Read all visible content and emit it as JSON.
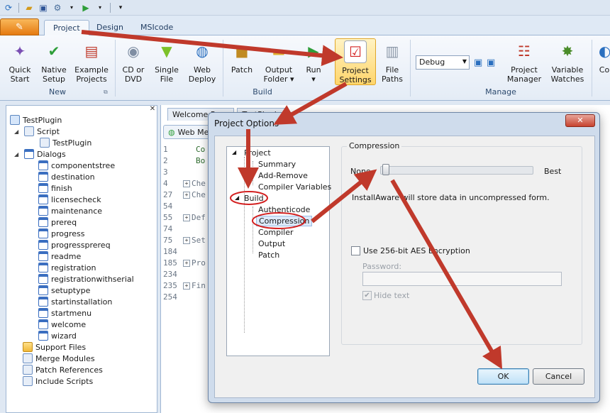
{
  "ribbon": {
    "tabs": [
      "Project",
      "Design",
      "MSIcode"
    ],
    "groups": {
      "new": {
        "label": "New",
        "buttons": [
          {
            "line1": "Quick",
            "line2": "Start",
            "icon": "wand-icon"
          },
          {
            "line1": "Native",
            "line2": "Setup",
            "icon": "check-circle-icon"
          },
          {
            "line1": "Example",
            "line2": "Projects",
            "icon": "document-stack-icon"
          }
        ]
      },
      "build": {
        "label": "Build",
        "buttons": [
          {
            "line1": "CD or",
            "line2": "DVD",
            "icon": "disc-icon"
          },
          {
            "line1": "Single",
            "line2": "File",
            "icon": "funnel-icon"
          },
          {
            "line1": "Web",
            "line2": "Deploy",
            "icon": "globe-icon"
          },
          {
            "line1": "Patch",
            "line2": "",
            "icon": "box-icon"
          },
          {
            "line1": "Output",
            "line2": "Folder ▾",
            "icon": "folder-icon"
          },
          {
            "line1": "Run",
            "line2": "▾",
            "icon": "play-icon"
          },
          {
            "line1": "Project",
            "line2": "Settings",
            "icon": "checklist-icon"
          },
          {
            "line1": "File",
            "line2": "Paths",
            "icon": "server-icon"
          }
        ]
      },
      "manage": {
        "label": "Manage",
        "config": "Debug",
        "buttons": [
          {
            "line1": "Project",
            "line2": "Manager",
            "icon": "hierarchy-icon"
          },
          {
            "line1": "Variable",
            "line2": "Watches",
            "icon": "bug-icon"
          }
        ],
        "partial": "Co"
      }
    }
  },
  "tree": {
    "root": "TestPlugin",
    "script": "Script",
    "script_child": "TestPlugin",
    "dialogs": "Dialogs",
    "dialog_items": [
      "componentstree",
      "destination",
      "finish",
      "licensecheck",
      "maintenance",
      "prereq",
      "progress",
      "progressprereq",
      "readme",
      "registration",
      "registrationwithserial",
      "setuptype",
      "startinstallation",
      "startmenu",
      "welcome",
      "wizard"
    ],
    "extras": [
      "Support Files",
      "Merge Modules",
      "Patch References",
      "Include Scripts"
    ]
  },
  "editor": {
    "tabs": [
      "Welcome Page",
      "TestPlugin"
    ],
    "web_media": "Web Me",
    "lines": [
      {
        "num": "1",
        "text": "Co"
      },
      {
        "num": "2",
        "text": "Bo"
      },
      {
        "num": "3",
        "text": ""
      },
      {
        "num": "4",
        "text": "Che",
        "fold": true
      },
      {
        "num": "27",
        "text": "Che",
        "fold": true
      },
      {
        "num": "54",
        "text": ""
      },
      {
        "num": "55",
        "text": "Def",
        "fold": true
      },
      {
        "num": "74",
        "text": ""
      },
      {
        "num": "75",
        "text": "Set",
        "fold": true
      },
      {
        "num": "184",
        "text": ""
      },
      {
        "num": "185",
        "text": "Pro",
        "fold": true
      },
      {
        "num": "234",
        "text": ""
      },
      {
        "num": "235",
        "text": "Fin",
        "fold": true
      },
      {
        "num": "254",
        "text": ""
      }
    ]
  },
  "dialog": {
    "title": "Project Options",
    "close": "✕",
    "tree": {
      "project": "Project",
      "project_children": [
        "Summary",
        "Add-Remove",
        "Compiler Variables"
      ],
      "build": "Build",
      "build_children": [
        "Authenticode",
        "Compression",
        "Compiler",
        "Output",
        "Patch"
      ],
      "selected": "Compression"
    },
    "compression": {
      "legend": "Compression",
      "none": "None",
      "best": "Best",
      "level": 0,
      "description": "InstallAware will store data in uncompressed form."
    },
    "aes_label": "Use 256-bit AES Encryption",
    "password_label": "Password:",
    "hide_text_label": "Hide text",
    "ok": "OK",
    "cancel": "Cancel"
  },
  "colors": {
    "annotation_arrow": "#c0392b",
    "annotation_circle": "#d32020",
    "highlight": "#ffd56b"
  }
}
